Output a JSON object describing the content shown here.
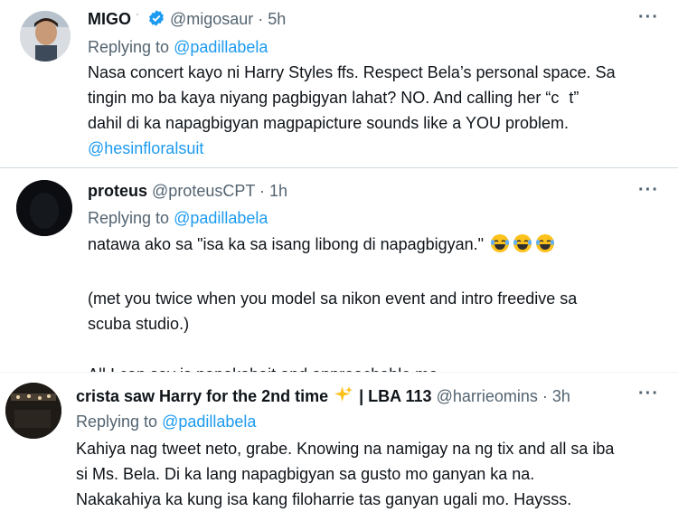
{
  "tweets": [
    {
      "display_name": "MIGO",
      "name_suffix": "ˑ",
      "handle": "@migosaur",
      "time": "· 5h",
      "replying_prefix": "Replying to",
      "replying_to": "@padillabela",
      "lines": [
        "Nasa concert kayo ni Harry Styles ffs. Respect Bela’s personal space. Sa",
        "tingin mo ba kaya niyang pagbigyan lahat? NO. And calling her “c   t”",
        "dahil di ka napagbigyan magpapicture sounds like a YOU problem."
      ],
      "mention": "@hesinfloralsuit",
      "verified": true
    },
    {
      "display_name": "proteus",
      "handle": "@proteusCPT",
      "time": "· 1h",
      "replying_prefix": "Replying to",
      "replying_to": "@padillabela",
      "line1": "natawa ako sa \"isa ka sa isang libong di napagbigyan.\"",
      "para2": [
        "(met you twice when you model sa nikon event and intro freedive sa",
        "scuba studio.)"
      ],
      "para3": "All I can say is napakabait and approachable mo."
    },
    {
      "display_name_a": "crista saw Harry for the 2nd time",
      "display_name_b": "| LBA 113",
      "handle": "@harrieomins",
      "time": "· 3h",
      "replying_prefix": "Replying to",
      "replying_to": "@padillabela",
      "lines": [
        "Kahiya nag tweet neto, grabe. Knowing na namigay na ng tix and all sa iba",
        "si Ms. Bela. Di ka lang napagbigyan sa gusto mo ganyan ka na.",
        "Nakakahiya ka kung isa kang filoharrie tas ganyan ugali mo. Haysss."
      ]
    }
  ],
  "more_label": "···",
  "colors": {
    "link": "#1d9bf0",
    "muted": "#536471",
    "text": "#0f1419",
    "verified": "#1d9bf0"
  }
}
